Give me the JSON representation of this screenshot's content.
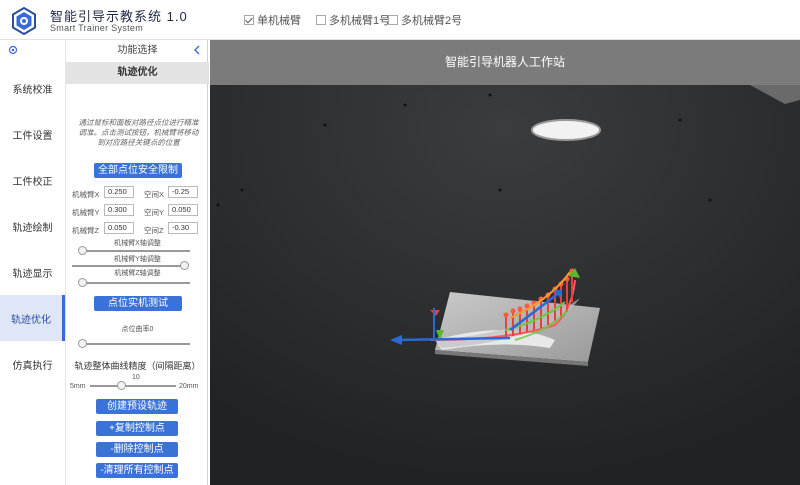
{
  "header": {
    "title": "智能引导示教系统 1.0",
    "subtitle": "Smart Trainer System",
    "modes": [
      {
        "label": "单机械臂",
        "checked": true
      },
      {
        "label": "多机械臂1号",
        "checked": false
      },
      {
        "label": "多机械臂2号",
        "checked": false
      }
    ]
  },
  "nav": {
    "items": [
      "系统校准",
      "工件设置",
      "工件校正",
      "轨迹绘制",
      "轨迹显示",
      "轨迹优化",
      "仿真执行"
    ],
    "active_index": 5
  },
  "panel": {
    "header": "功能选择",
    "tab": "轨迹优化",
    "description": "通过鼠标和面板对路径点位进行精准调准。点击测试按钮，机械臂将移动到对应路径关键点的位置",
    "safety_button": "全部点位安全限制",
    "fields": [
      {
        "label": "机械臂X",
        "value": "0.250"
      },
      {
        "label": "空间X",
        "value": "-0.25"
      },
      {
        "label": "机械臂Y",
        "value": "0.300"
      },
      {
        "label": "空间Y",
        "value": "0.050"
      },
      {
        "label": "机械臂Z",
        "value": "0.050"
      },
      {
        "label": "空间Z",
        "value": "-0.30"
      }
    ],
    "sliders": [
      {
        "label": "机械臂X轴调整",
        "level": 0.03
      },
      {
        "label": "机械臂Y轴调整",
        "level": 0.97
      },
      {
        "label": "机械臂Z轴调整",
        "level": 0.03
      }
    ],
    "test_button": "点位实机测试",
    "curvature": {
      "label": "点位曲率0",
      "level": 0.03
    },
    "precision": {
      "title": "轨迹整体曲线精度（间隔距离）",
      "value": "10",
      "min_label": "5mm",
      "max_label": "20mm",
      "level": 0.33
    },
    "actions": [
      "创建预设轨迹",
      "+复制控制点",
      "-删除控制点",
      "-清理所有控制点"
    ]
  },
  "viewport": {
    "title": "智能引导机器人工作站"
  },
  "colors": {
    "accent": "#3a72d8",
    "viewport_bg": "#2c2e30",
    "viewport_bar": "#7b7b7b"
  }
}
